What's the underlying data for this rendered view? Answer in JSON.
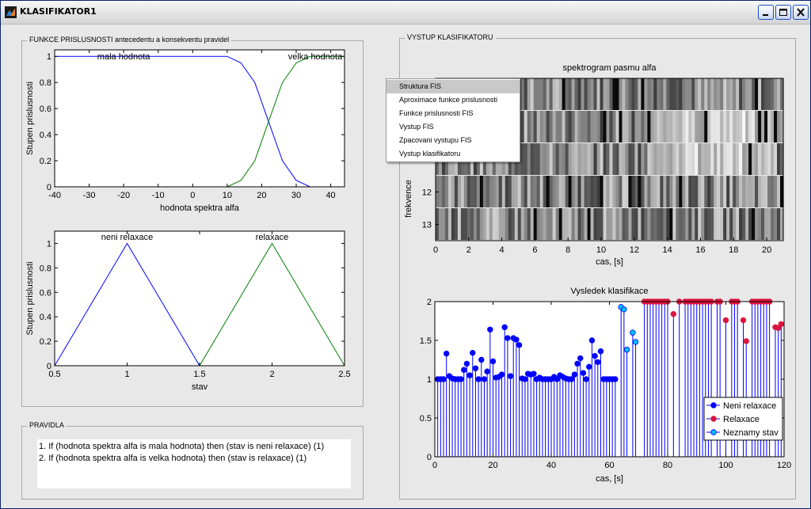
{
  "window": {
    "title": "KLASIFIKATOR1"
  },
  "groups": {
    "membership": "FUNKCE PRISLUSNOSTI antecedentu a konsekventu pravidel",
    "output": "VYSTUP KLASIFIKATORU",
    "rules": "PRAVIDLA"
  },
  "rules": [
    "1. If (hodnota spektra alfa is mala hodnota) then (stav is neni relaxace) (1)",
    "2. If (hodnota spektra alfa is velka hodnota) then (stav is relaxace) (1)"
  ],
  "context_menu": {
    "items": [
      "Struktura FIS",
      "Aproximace funkce prislusnosti",
      "Funkce prislusnosti FIS",
      "Vystup FIS",
      "Zpacovani vystupu FIS",
      "Vystup klasifikatoru"
    ],
    "highlighted": 0
  },
  "colors": {
    "blue": "#0000ff",
    "green": "#008000",
    "cyan": "#00bfff",
    "red": "#dc143c"
  },
  "chart_data": [
    {
      "type": "line",
      "xlim": [
        -40,
        44
      ],
      "ylim": [
        0,
        1.05
      ],
      "xticks": [
        -40,
        -30,
        -20,
        -10,
        0,
        10,
        20,
        30,
        40
      ],
      "yticks": [
        0,
        0.2,
        0.4,
        0.6,
        0.8,
        1
      ],
      "xlabel": "hodnota spektra alfa",
      "ylabel": "Stupen prislusnosti",
      "series": [
        {
          "name": "mala hodnota",
          "x": [
            -40,
            10,
            14,
            18,
            22,
            26,
            30,
            34,
            44
          ],
          "y": [
            1,
            1,
            0.95,
            0.8,
            0.5,
            0.2,
            0.05,
            0,
            0
          ]
        },
        {
          "name": "velka hodnota",
          "x": [
            -40,
            10,
            14,
            18,
            22,
            26,
            30,
            34,
            44
          ],
          "y": [
            0,
            0,
            0.05,
            0.2,
            0.5,
            0.8,
            0.95,
            1,
            1
          ]
        }
      ]
    },
    {
      "type": "line",
      "xlim": [
        0.5,
        2.5
      ],
      "ylim": [
        0,
        1.1
      ],
      "xticks": [
        0.5,
        1,
        1.5,
        2,
        2.5
      ],
      "yticks": [
        0,
        0.2,
        0.4,
        0.6,
        0.8,
        1
      ],
      "xlabel": "stav",
      "ylabel": "Stupen prislusnosti",
      "series": [
        {
          "name": "neni relaxace",
          "x": [
            0.5,
            1,
            1.5,
            2.5
          ],
          "y": [
            0,
            1,
            0,
            0
          ]
        },
        {
          "name": "relaxace",
          "x": [
            0.5,
            1.5,
            2,
            2.5
          ],
          "y": [
            0,
            0,
            1,
            0
          ]
        }
      ]
    },
    {
      "type": "heatmap",
      "title": "spektrogram pasmu alfa",
      "xlabel": "cas, [s]",
      "ylabel": "frekvence",
      "xlim": [
        0,
        21
      ],
      "xticks": [
        0,
        2,
        4,
        6,
        8,
        10,
        12,
        14,
        16,
        18,
        20
      ],
      "yticks": [
        12,
        13
      ]
    },
    {
      "type": "scatter",
      "title": "Vysledek klasifikace",
      "xlabel": "cas, [s]",
      "xlim": [
        0,
        120
      ],
      "ylim": [
        0,
        2
      ],
      "xticks": [
        0,
        20,
        40,
        60,
        80,
        100,
        120
      ],
      "yticks": [
        0,
        0.5,
        1,
        1.5,
        2
      ],
      "legend": [
        "Neni relaxace",
        "Relaxace",
        "Neznamy stav"
      ],
      "legend_position": "bottom-right",
      "series": [
        {
          "name": "Neni relaxace",
          "x": [
            1,
            2,
            3,
            4,
            5,
            6,
            7,
            8,
            9,
            10,
            11,
            12,
            13,
            14,
            15,
            16,
            17,
            18,
            19,
            20,
            21,
            22,
            23,
            24,
            25,
            26,
            27,
            28,
            29,
            30,
            31,
            32,
            33,
            34,
            35,
            36,
            37,
            38,
            39,
            40,
            41,
            42,
            43,
            44,
            45,
            46,
            47,
            48,
            49,
            50,
            51,
            52,
            53,
            54,
            55,
            56,
            57,
            58,
            59,
            60,
            61,
            62
          ],
          "y": [
            1,
            1,
            1,
            1.33,
            1.04,
            1.01,
            1,
            1,
            1,
            1.12,
            1.2,
            1.05,
            1.34,
            1.14,
            1,
            1.25,
            1,
            1.1,
            1.64,
            1.23,
            1.02,
            1.03,
            1.06,
            1.67,
            1.53,
            1.04,
            1.53,
            1.51,
            1.44,
            1.01,
            1,
            1.07,
            1.06,
            1.07,
            1,
            1.02,
            1,
            1,
            1,
            1,
            1.03,
            1,
            1.05,
            1.03,
            1.01,
            1,
            1,
            1.06,
            1.2,
            1.27,
            1.08,
            1,
            1.16,
            1.5,
            1.3,
            1.22,
            1.36,
            1,
            1,
            1,
            1,
            1
          ]
        },
        {
          "name": "Relaxace",
          "x": [
            72,
            73,
            74,
            75,
            76,
            77,
            78,
            79,
            80,
            82,
            84,
            86,
            87,
            88,
            89,
            90,
            91,
            92,
            93,
            94,
            95,
            97,
            98,
            100,
            102,
            103,
            104,
            106,
            107,
            109,
            110,
            111,
            112,
            113,
            114,
            115,
            117,
            118,
            119
          ],
          "y": [
            2,
            2,
            2,
            2,
            2,
            2,
            2,
            2,
            2,
            1.84,
            2,
            2,
            2,
            2,
            2,
            2,
            2,
            2,
            2,
            2,
            2,
            2,
            2,
            1.76,
            2,
            2,
            2,
            1.76,
            1.49,
            2,
            2,
            2,
            2,
            2,
            2,
            2,
            1.67,
            1.66,
            1.71
          ]
        },
        {
          "name": "Neznamy stav",
          "x": [
            64,
            65,
            66,
            68,
            69
          ],
          "y": [
            1.93,
            1.9,
            1.38,
            1.6,
            1.48
          ]
        }
      ]
    }
  ]
}
